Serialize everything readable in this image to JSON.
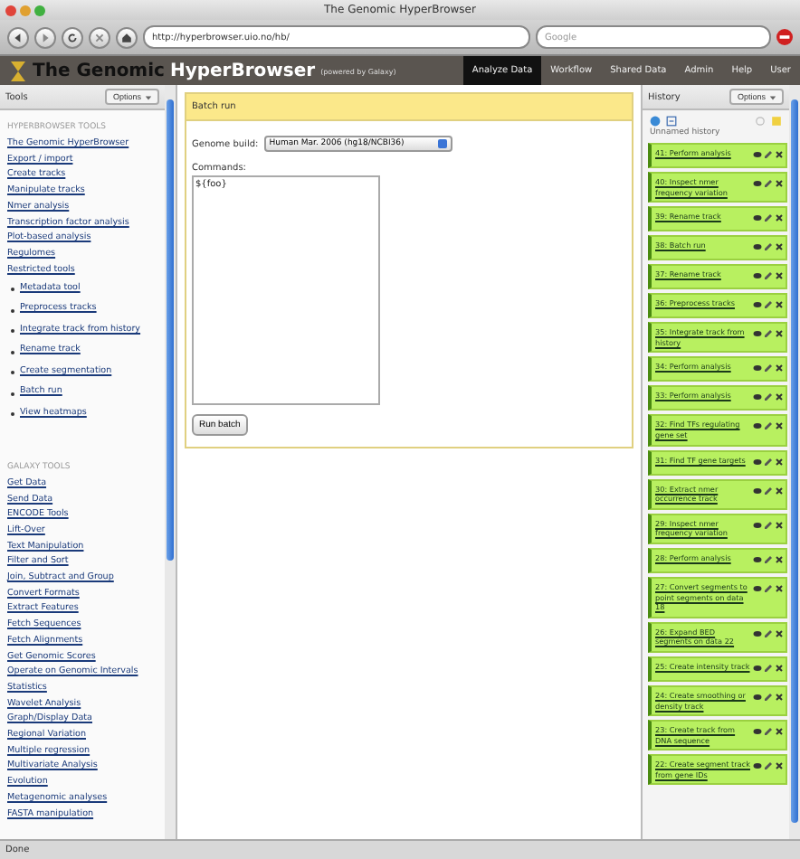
{
  "browser": {
    "title": "The Genomic HyperBrowser",
    "url": "http://hyperbrowser.uio.no/hb/",
    "search_placeholder": "Google"
  },
  "masthead": {
    "brand": "The Genomic",
    "brand_strong": "HyperBrowser",
    "powered": "(powered by Galaxy)",
    "nav": [
      {
        "label": "Analyze Data",
        "selected": true
      },
      {
        "label": "Workflow",
        "selected": false
      },
      {
        "label": "Shared Data",
        "selected": false
      },
      {
        "label": "Admin",
        "selected": false
      },
      {
        "label": "Help",
        "selected": false
      },
      {
        "label": "User",
        "selected": false
      }
    ]
  },
  "tools": {
    "title": "Tools",
    "options": "Options",
    "sections": [
      {
        "heading": "HYPERBROWSER TOOLS",
        "items": [
          {
            "label": "The Genomic HyperBrowser",
            "kind": "link"
          },
          {
            "label": "Export / import",
            "kind": "link"
          },
          {
            "label": "Create tracks",
            "kind": "link"
          },
          {
            "label": "Manipulate tracks",
            "kind": "link"
          },
          {
            "label": "Nmer analysis",
            "kind": "link"
          },
          {
            "label": "Transcription factor analysis",
            "kind": "link"
          },
          {
            "label": "Plot-based analysis",
            "kind": "link"
          },
          {
            "label": "Regulomes",
            "kind": "link"
          },
          {
            "label": "Restricted tools",
            "kind": "link"
          },
          {
            "label": "Metadata tool",
            "kind": "bullet"
          },
          {
            "label": "Preprocess tracks",
            "kind": "bullet"
          },
          {
            "label": "Integrate track from history",
            "kind": "bullet"
          },
          {
            "label": "Rename track",
            "kind": "bullet"
          },
          {
            "label": "Create segmentation",
            "kind": "bullet"
          },
          {
            "label": "Batch run",
            "kind": "bullet"
          },
          {
            "label": "View heatmaps",
            "kind": "bullet"
          }
        ]
      },
      {
        "heading": "GALAXY TOOLS",
        "items": [
          {
            "label": "Get Data",
            "kind": "link"
          },
          {
            "label": "Send Data",
            "kind": "link"
          },
          {
            "label": "ENCODE Tools",
            "kind": "link"
          },
          {
            "label": "Lift-Over",
            "kind": "link"
          },
          {
            "label": "Text Manipulation",
            "kind": "link"
          },
          {
            "label": "Filter and Sort",
            "kind": "link"
          },
          {
            "label": "Join, Subtract and Group",
            "kind": "link"
          },
          {
            "label": "Convert Formats",
            "kind": "link"
          },
          {
            "label": "Extract Features",
            "kind": "link"
          },
          {
            "label": "Fetch Sequences",
            "kind": "link"
          },
          {
            "label": "Fetch Alignments",
            "kind": "link"
          },
          {
            "label": "Get Genomic Scores",
            "kind": "link"
          },
          {
            "label": "Operate on Genomic Intervals",
            "kind": "link"
          },
          {
            "label": "Statistics",
            "kind": "link"
          },
          {
            "label": "Wavelet Analysis",
            "kind": "link"
          },
          {
            "label": "Graph/Display Data",
            "kind": "link"
          },
          {
            "label": "Regional Variation",
            "kind": "link"
          },
          {
            "label": "Multiple regression",
            "kind": "link"
          },
          {
            "label": "Multivariate Analysis",
            "kind": "link"
          },
          {
            "label": "Evolution",
            "kind": "link"
          },
          {
            "label": "Metagenomic analyses",
            "kind": "link"
          },
          {
            "label": "FASTA manipulation",
            "kind": "link"
          }
        ]
      }
    ]
  },
  "form": {
    "title": "Batch run",
    "genome_label": "Genome build:",
    "genome_value": "Human Mar. 2006 (hg18/NCBI36)",
    "commands_label": "Commands:",
    "commands_value": "${foo}",
    "submit": "Run batch"
  },
  "history": {
    "title": "History",
    "options": "Options",
    "name": "Unnamed history",
    "items": [
      {
        "label": "41: Perform analysis"
      },
      {
        "label": "40: Inspect nmer frequency variation"
      },
      {
        "label": "39: Rename track"
      },
      {
        "label": "38: Batch run"
      },
      {
        "label": "37: Rename track"
      },
      {
        "label": "36: Preprocess tracks"
      },
      {
        "label": "35: Integrate track from history"
      },
      {
        "label": "34: Perform analysis"
      },
      {
        "label": "33: Perform analysis"
      },
      {
        "label": "32: Find TFs regulating gene set"
      },
      {
        "label": "31: Find TF gene targets"
      },
      {
        "label": "30: Extract nmer occurrence track"
      },
      {
        "label": "29: Inspect nmer frequency variation"
      },
      {
        "label": "28: Perform analysis"
      },
      {
        "label": "27: Convert segments to point segments on data 18"
      },
      {
        "label": "26: Expand BED segments on data 22"
      },
      {
        "label": "25: Create intensity track"
      },
      {
        "label": "24: Create smoothing or density track"
      },
      {
        "label": "23: Create track from DNA sequence"
      },
      {
        "label": "22: Create segment track from gene IDs"
      }
    ]
  },
  "status": "Done"
}
